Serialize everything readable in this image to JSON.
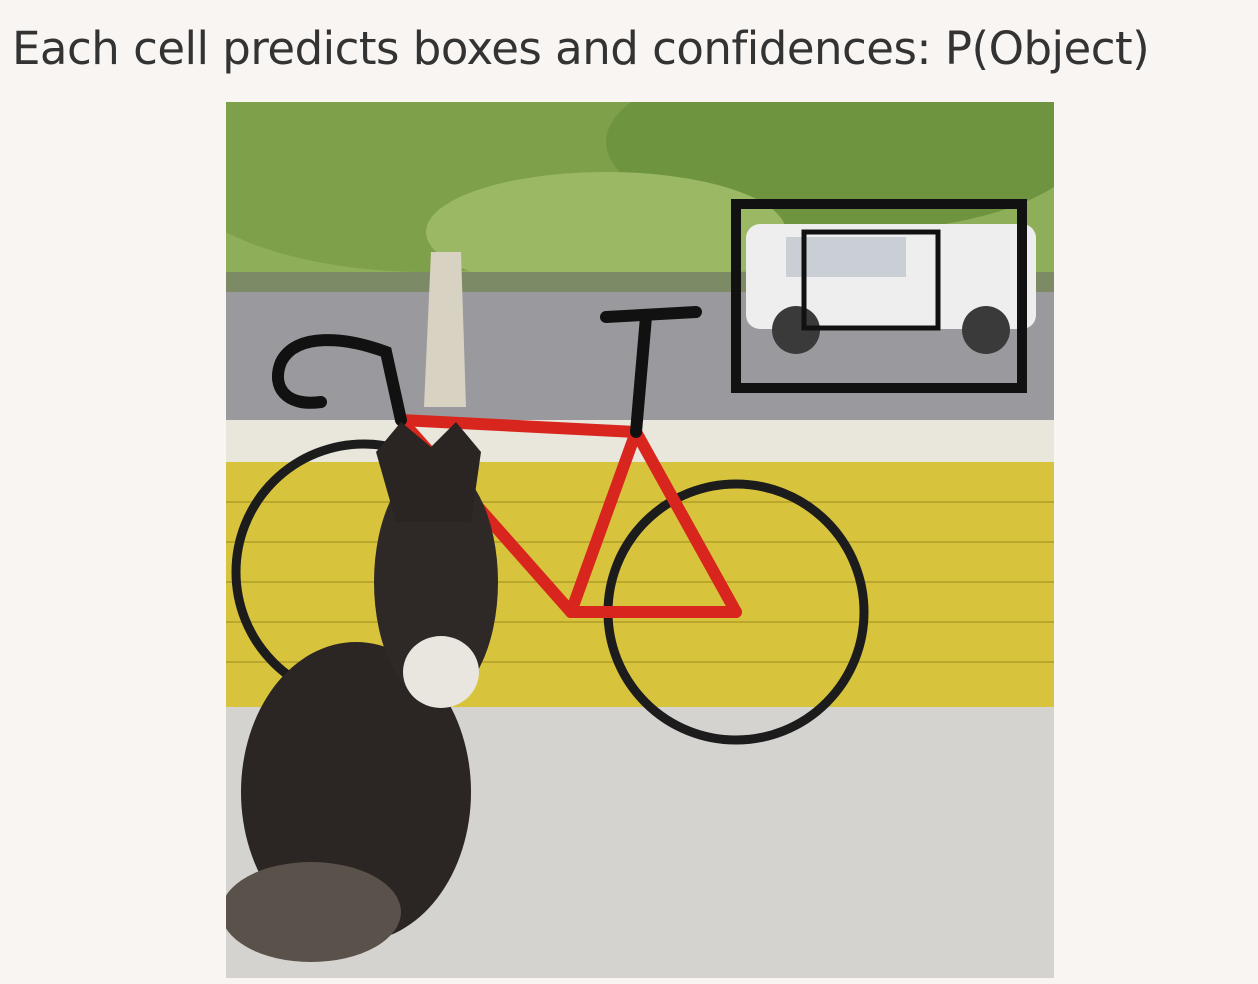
{
  "slide": {
    "title": "Each cell predicts boxes and confidences: P(Object)"
  },
  "photo": {
    "subject": "dog-bicycle-car-scene",
    "objects": [
      "dog",
      "bicycle",
      "car"
    ],
    "predicted_boxes_count": 2
  },
  "colors": {
    "background": "#f8f5f3",
    "title_text": "#333333",
    "box_stroke": "#111111",
    "bike_frame": "#d8261e",
    "wall_yellow": "#d8c43c"
  }
}
